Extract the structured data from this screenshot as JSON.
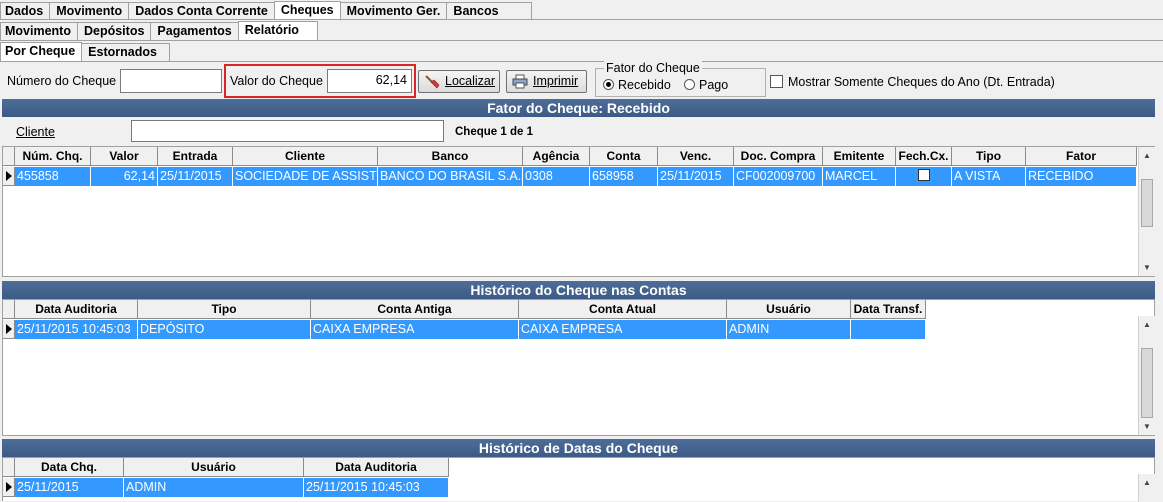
{
  "tabs_row1": [
    "Dados",
    "Movimento",
    "Dados Conta Corrente",
    "Cheques",
    "Movimento Ger.",
    "Bancos"
  ],
  "tabs_row2": [
    "Movimento",
    "Depósitos",
    "Pagamentos",
    "Relatório"
  ],
  "tabs_row3": [
    "Por Cheque",
    "Estornados"
  ],
  "filters": {
    "numero_label": "Número do Cheque",
    "numero_value": "",
    "valor_label": "Valor do Cheque",
    "valor_value": "62,14",
    "localizar_label": "Localizar",
    "imprimir_label": "Imprimir",
    "fator_group_label": "Fator do Cheque",
    "fator_options": [
      "Recebido",
      "Pago"
    ],
    "mostrar_label": "Mostrar Somente Cheques do Ano (Dt. Entrada)"
  },
  "section1": {
    "title": "Fator do Cheque: Recebido",
    "cliente_label": "Cliente",
    "cliente_value": "",
    "count_label": "Cheque 1 de 1",
    "columns": [
      "Núm. Chq.",
      "Valor",
      "Entrada",
      "Cliente",
      "Banco",
      "Agência",
      "Conta",
      "Venc.",
      "Doc. Compra",
      "Emitente",
      "Fech.Cx.",
      "Tipo",
      "Fator"
    ],
    "row": [
      "455858",
      "62,14",
      "25/11/2015",
      "SOCIEDADE DE ASSISTÊNCIA",
      "BANCO DO BRASIL S.A.",
      "0308",
      "658958",
      "25/11/2015",
      "CF002009700",
      "MARCEL",
      "",
      "A VISTA",
      "RECEBIDO"
    ]
  },
  "section2": {
    "title": "Histórico do Cheque nas Contas",
    "columns": [
      "Data Auditoria",
      "Tipo",
      "Conta Antiga",
      "Conta Atual",
      "Usuário",
      "Data Transf."
    ],
    "row": [
      "25/11/2015 10:45:03",
      "DEPÓSITO",
      "CAIXA EMPRESA",
      "CAIXA EMPRESA",
      "ADMIN",
      ""
    ]
  },
  "section3": {
    "title": "Histórico de Datas do Cheque",
    "columns": [
      "Data Chq.",
      "Usuário",
      "Data Auditoria"
    ],
    "row": [
      "25/11/2015",
      "ADMIN",
      "25/11/2015 10:45:03"
    ]
  },
  "colors": {
    "highlight_border": "#d9252a",
    "selected_row": "#3399ff",
    "section_bar": "#3f5e8a"
  }
}
